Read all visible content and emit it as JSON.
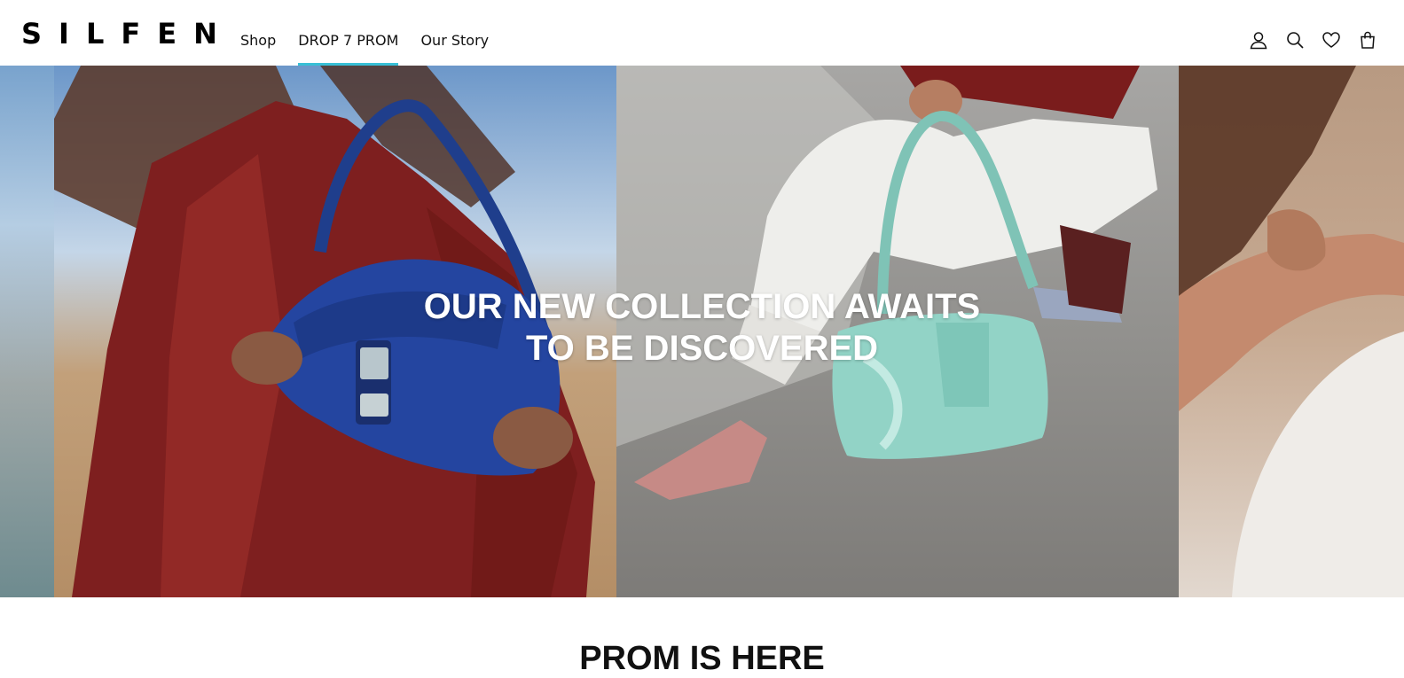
{
  "brand": {
    "logo_text": "SILFEN"
  },
  "nav": {
    "items": [
      {
        "label": "Shop",
        "active": false
      },
      {
        "label": "DROP 7 PROM",
        "active": true
      },
      {
        "label": "Our Story",
        "active": false
      }
    ]
  },
  "header_icons": [
    "account-icon",
    "search-icon",
    "wishlist-heart-icon",
    "cart-bag-icon"
  ],
  "hero": {
    "line1": "OUR NEW COLLECTION AWAITS",
    "line2": "TO BE DISCOVERED"
  },
  "section": {
    "title": "PROM IS HERE"
  },
  "colors": {
    "active_underline": "#38bfd6",
    "hero_text": "#ffffff",
    "text": "#111111"
  }
}
